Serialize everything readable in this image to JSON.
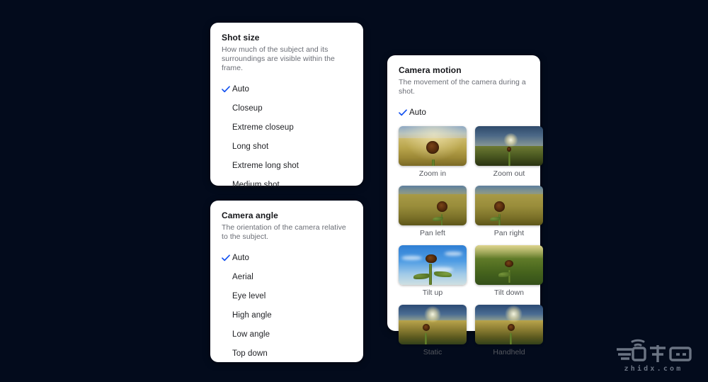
{
  "background_color": "#030b1c",
  "accent_color": "#1452f0",
  "panels": {
    "shot_size": {
      "title": "Shot size",
      "description": "How much of the subject and its surroundings are visible within the frame.",
      "options": [
        {
          "label": "Auto",
          "checked": true
        },
        {
          "label": "Closeup",
          "checked": false
        },
        {
          "label": "Extreme closeup",
          "checked": false
        },
        {
          "label": "Long shot",
          "checked": false
        },
        {
          "label": "Extreme long shot",
          "checked": false
        },
        {
          "label": "Medium shot",
          "checked": false
        }
      ]
    },
    "camera_angle": {
      "title": "Camera angle",
      "description": "The orientation of the camera relative to the subject.",
      "options": [
        {
          "label": "Auto",
          "checked": true
        },
        {
          "label": "Aerial",
          "checked": false
        },
        {
          "label": "Eye level",
          "checked": false
        },
        {
          "label": "High angle",
          "checked": false
        },
        {
          "label": "Low angle",
          "checked": false
        },
        {
          "label": "Top down",
          "checked": false
        }
      ]
    },
    "camera_motion": {
      "title": "Camera motion",
      "description": "The movement of the camera during a shot.",
      "options": [
        {
          "label": "Auto",
          "checked": true
        }
      ],
      "thumbnails": [
        {
          "label": "Zoom in",
          "art": "t-zoomin",
          "scene": "sunflower-closeup-golden-field"
        },
        {
          "label": "Zoom out",
          "art": "t-zoomout",
          "scene": "sunflower-distant-sunset-field"
        },
        {
          "label": "Pan left",
          "art": "t-panleft",
          "scene": "sunflower-right-of-frame-field"
        },
        {
          "label": "Pan right",
          "art": "t-panright",
          "scene": "sunflower-left-of-frame-field"
        },
        {
          "label": "Tilt up",
          "art": "t-tiltup",
          "scene": "sunflower-against-blue-sky"
        },
        {
          "label": "Tilt down",
          "art": "t-tiltdown",
          "scene": "sunflower-in-green-grass-overhead"
        },
        {
          "label": "Static",
          "art": "t-static",
          "scene": "sunflower-centered-sunset-field"
        },
        {
          "label": "Handheld",
          "art": "t-handheld",
          "scene": "sunflower-centered-sunset-field"
        }
      ]
    }
  },
  "watermark": {
    "text": "zhidx.com",
    "color": "#7e8796"
  }
}
